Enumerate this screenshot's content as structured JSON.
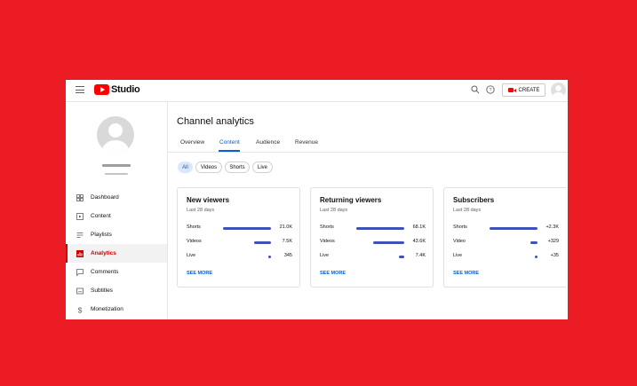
{
  "app": {
    "logo_text": "Studio",
    "create_label": "CREATE"
  },
  "sidebar": {
    "items": [
      {
        "label": "Dashboard",
        "icon": "dashboard-icon"
      },
      {
        "label": "Content",
        "icon": "content-icon"
      },
      {
        "label": "Playlists",
        "icon": "playlists-icon"
      },
      {
        "label": "Analytics",
        "icon": "analytics-icon",
        "active": true
      },
      {
        "label": "Comments",
        "icon": "comments-icon"
      },
      {
        "label": "Subtitles",
        "icon": "subtitles-icon"
      },
      {
        "label": "Monetization",
        "icon": "monetization-icon"
      }
    ]
  },
  "main": {
    "title": "Channel analytics",
    "tabs": [
      "Overview",
      "Content",
      "Audience",
      "Revenue"
    ],
    "active_tab": "Content",
    "chips": [
      "All",
      "Videos",
      "Shorts",
      "Live"
    ],
    "active_chip": "All"
  },
  "cards": [
    {
      "title": "New viewers",
      "subtitle": "Last 28 days",
      "rows": [
        {
          "label": "Shorts",
          "value": "21.0K",
          "fraction": 1.0
        },
        {
          "label": "Videos",
          "value": "7.5K",
          "fraction": 0.36
        },
        {
          "label": "Live",
          "value": "345",
          "fraction": 0.02
        }
      ],
      "see_more": "SEE MORE"
    },
    {
      "title": "Returning viewers",
      "subtitle": "Last 28 days",
      "rows": [
        {
          "label": "Shorts",
          "value": "68.1K",
          "fraction": 1.0
        },
        {
          "label": "Videos",
          "value": "43.6K",
          "fraction": 0.64
        },
        {
          "label": "Live",
          "value": "7.4K",
          "fraction": 0.11
        }
      ],
      "see_more": "SEE MORE"
    },
    {
      "title": "Subscribers",
      "subtitle": "Last 28 days",
      "rows": [
        {
          "label": "Shorts",
          "value": "+2.3K",
          "fraction": 1.0
        },
        {
          "label": "Video",
          "value": "+329",
          "fraction": 0.14
        },
        {
          "label": "Live",
          "value": "+35",
          "fraction": 0.02
        }
      ],
      "see_more": "SEE MORE"
    }
  ],
  "colors": {
    "brand": "#ff0000",
    "accent": "#065fd4",
    "bar": "#3f51b5",
    "background": "#ec1c24"
  }
}
